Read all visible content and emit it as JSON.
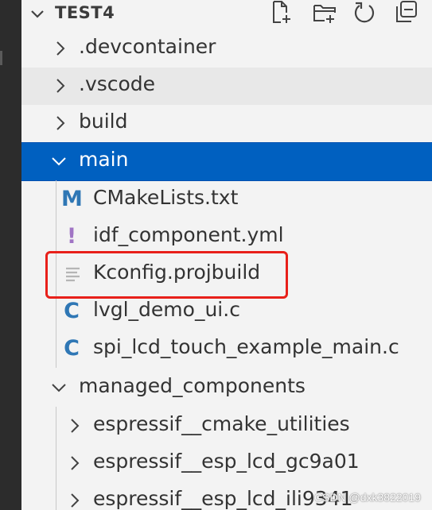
{
  "explorer": {
    "root_title": "TEST4",
    "actions": [
      {
        "name": "new-file-icon"
      },
      {
        "name": "new-folder-icon"
      },
      {
        "name": "refresh-icon"
      },
      {
        "name": "collapse-all-icon"
      }
    ]
  },
  "tree": [
    {
      "label": ".devcontainer",
      "type": "folder",
      "expanded": false
    },
    {
      "label": ".vscode",
      "type": "folder",
      "expanded": false
    },
    {
      "label": "build",
      "type": "folder",
      "expanded": false
    },
    {
      "label": "main",
      "type": "folder",
      "expanded": true
    },
    {
      "label": "CMakeLists.txt",
      "type": "file",
      "icon": "M",
      "icon_color": "#2f77b5"
    },
    {
      "label": "idf_component.yml",
      "type": "file",
      "icon": "!",
      "icon_color": "#a074c4"
    },
    {
      "label": "Kconfig.projbuild",
      "type": "file",
      "icon": "lines",
      "icon_color": "#b5b5b5"
    },
    {
      "label": "lvgl_demo_ui.c",
      "type": "file",
      "icon": "C",
      "icon_color": "#2f77b5"
    },
    {
      "label": "spi_lcd_touch_example_main.c",
      "type": "file",
      "icon": "C",
      "icon_color": "#2f77b5"
    },
    {
      "label": "managed_components",
      "type": "folder",
      "expanded": true
    },
    {
      "label": "espressif__cmake_utilities",
      "type": "folder",
      "expanded": false
    },
    {
      "label": "espressif__esp_lcd_gc9a01",
      "type": "folder",
      "expanded": false
    },
    {
      "label": "espressif__esp_lcd_ili9341",
      "type": "folder",
      "expanded": false
    }
  ],
  "colors": {
    "selection": "#0060c0",
    "highlight_box": "#e8201a"
  },
  "watermark": "CSDN @dxk3822019"
}
